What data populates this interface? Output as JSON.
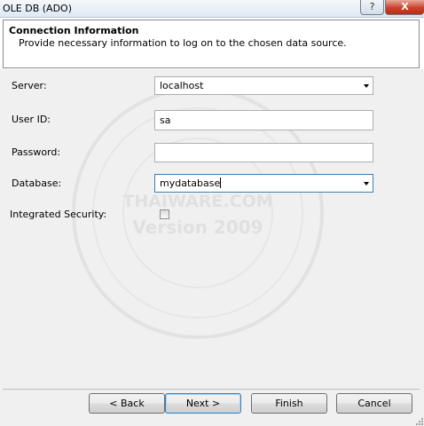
{
  "window": {
    "title": "OLE DB (ADO)",
    "help_label": "?",
    "close_label": "X"
  },
  "header": {
    "title": "Connection Information",
    "subtitle": "Provide necessary information to log on to the chosen data source."
  },
  "form": {
    "server": {
      "label": "Server:",
      "value": "localhost"
    },
    "user_id": {
      "label": "User ID:",
      "value": "sa"
    },
    "password": {
      "label": "Password:",
      "value": ""
    },
    "database": {
      "label": "Database:",
      "value": "mydatabase"
    },
    "integrated_security": {
      "label": "Integrated Security:",
      "checked": false
    }
  },
  "buttons": {
    "back": "< Back",
    "next": "Next >",
    "finish": "Finish",
    "cancel": "Cancel"
  },
  "watermark": {
    "line1": "THAIWARE.COM",
    "line2": "Version 2009"
  },
  "colors": {
    "content_bg": "#f0f0f0",
    "focus_border": "#3c7fb1"
  }
}
